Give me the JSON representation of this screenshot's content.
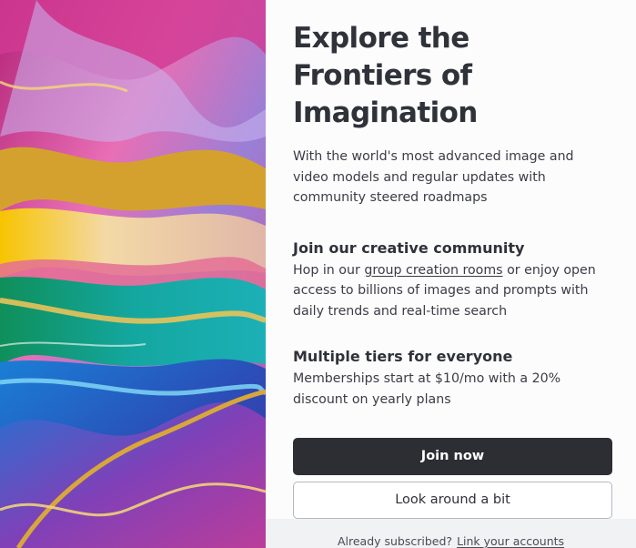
{
  "hero_image": {
    "icon": "abstract-marbled-art-image",
    "colors": [
      "#e2499a",
      "#d9a63a",
      "#1aa58b",
      "#1e62c8",
      "#7a3fa8"
    ]
  },
  "main": {
    "headline": "Explore the Frontiers of Imagination",
    "lead": "With the world's most advanced image and video models and regular updates with community steered roadmaps"
  },
  "sections": [
    {
      "title": "Join our creative community",
      "text_before": "Hop in our ",
      "link_text": "group creation rooms",
      "text_after": " or enjoy open access to billions of images and prompts with daily trends and real-time search"
    },
    {
      "title": "Multiple tiers for everyone",
      "text": "Memberships start at $10/mo with a 20% discount on yearly plans"
    }
  ],
  "buttons": {
    "primary_label": "Join now",
    "secondary_label": "Look around a bit"
  },
  "footer": {
    "prompt": "Already subscribed?",
    "link_text": "Link your accounts"
  },
  "colors": {
    "primary_button": "#2c2e33",
    "text": "#30323a",
    "footer_bg": "#f1f2f4"
  }
}
